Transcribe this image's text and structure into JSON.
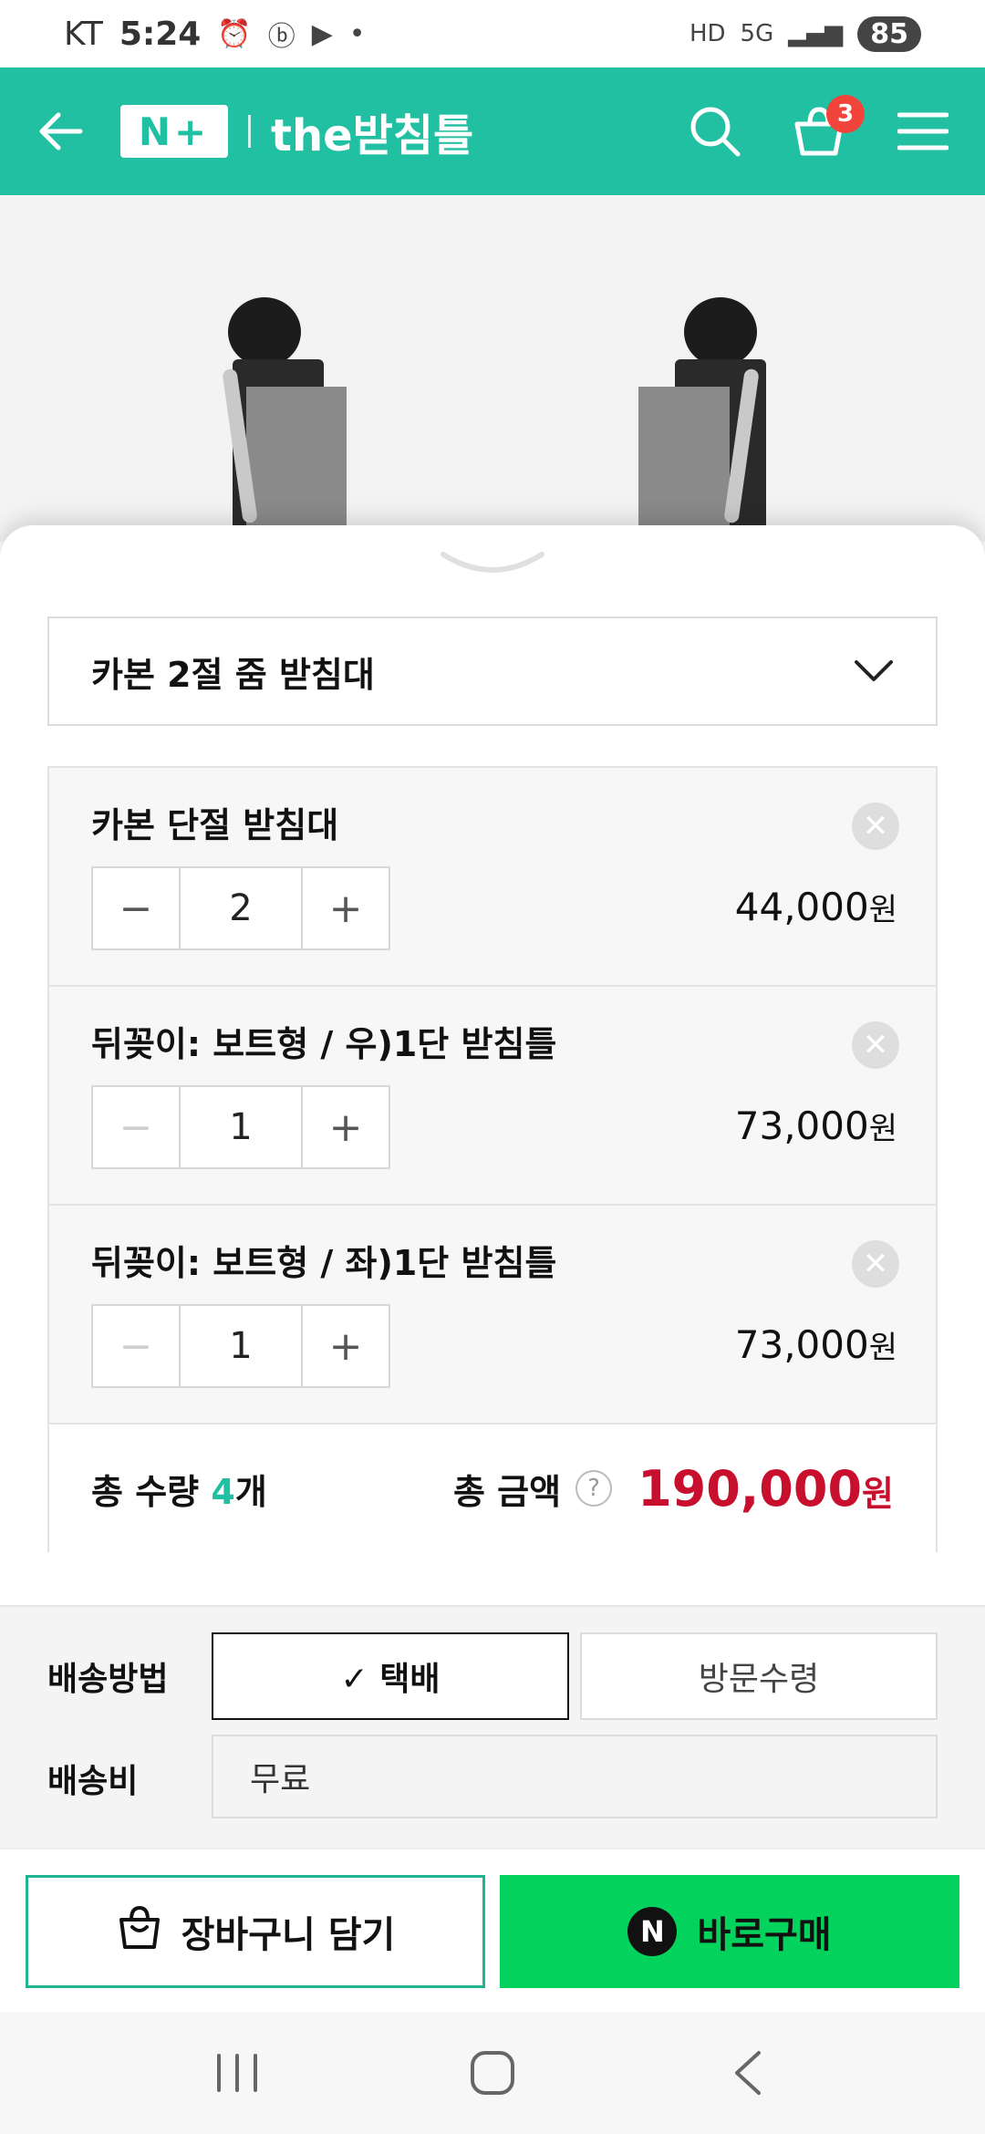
{
  "status_bar": {
    "carrier": "KT",
    "time": "5:24",
    "indicators": [
      "alarm-icon",
      "b-icon",
      "youtube-icon"
    ],
    "network": "5G",
    "hd": "HD",
    "battery": "85"
  },
  "header": {
    "logo_text": "N+",
    "store_name": "the받침틀",
    "cart_count": "3"
  },
  "option_select": {
    "selected": "카본 2절 줌 받침대"
  },
  "items": [
    {
      "name": "카본 단절 받침대",
      "qty": "2",
      "price": "44,000",
      "currency": "원"
    },
    {
      "name": "뒤꽂이: 보트형 / 우)1단 받침틀",
      "qty": "1",
      "price": "73,000",
      "currency": "원"
    },
    {
      "name": "뒤꽂이: 보트형 / 좌)1단 받침틀",
      "qty": "1",
      "price": "73,000",
      "currency": "원"
    }
  ],
  "totals": {
    "qty_label": "총 수량",
    "qty_value": "4",
    "qty_unit": "개",
    "amount_label": "총 금액",
    "help": "?",
    "amount": "190,000",
    "currency": "원"
  },
  "shipping": {
    "method_label": "배송방법",
    "options": [
      {
        "label": "✓ 택배",
        "selected": true
      },
      {
        "label": "방문수령",
        "selected": false
      }
    ],
    "fee_label": "배송비",
    "fee_value": "무료"
  },
  "cta": {
    "cart_label": "장바구니 담기",
    "buy_label": "바로구매",
    "npay_letter": "N"
  },
  "colors": {
    "brand": "#21c0a3",
    "price_red": "#c8102e",
    "buy_green": "#03d35c"
  }
}
